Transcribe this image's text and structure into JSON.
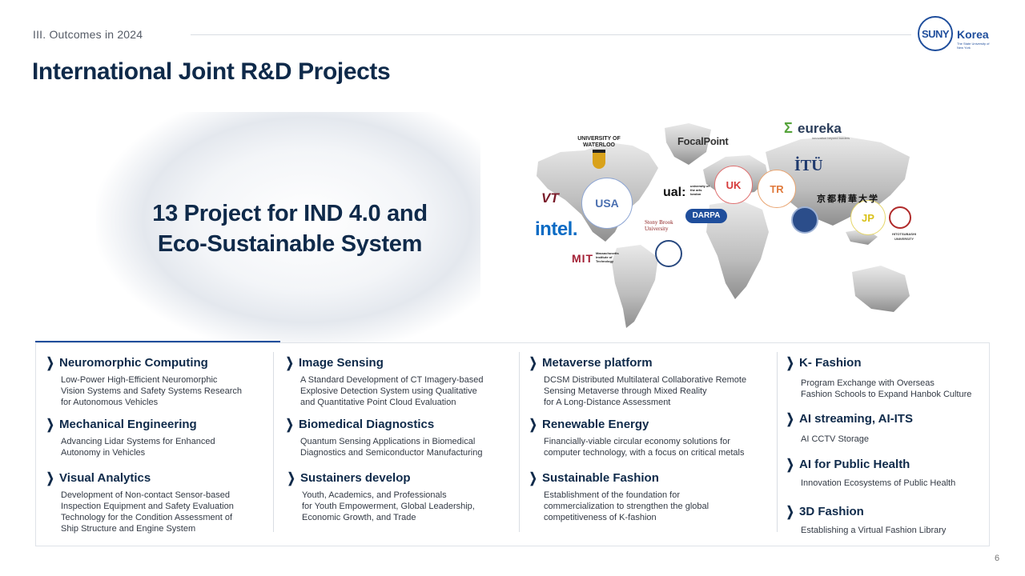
{
  "header": {
    "section_label": "III. Outcomes in 2024",
    "title": "International Joint R&D Projects"
  },
  "logo": {
    "mark": "SUNY",
    "word": "Korea",
    "subtitle": "The State University of New York"
  },
  "hero": {
    "line1": "13 Project for IND 4.0 and",
    "line2": "Eco-Sustainable System"
  },
  "map": {
    "countries": [
      {
        "code": "USA",
        "color": "#4a6fb0"
      },
      {
        "code": "UK",
        "color": "#d63a3a"
      },
      {
        "code": "TR",
        "color": "#e07a3c"
      },
      {
        "code": "JP",
        "color": "#d9c11a"
      }
    ],
    "partners": {
      "waterloo": "UNIVERSITY OF WATERLOO",
      "focalpoint": "FocalPoint",
      "eureka": "eureka",
      "eureka_tag": "innovation beyond borders",
      "itu": "İTÜ",
      "ual": "ual:",
      "ual_sub": "university of the arts london",
      "stony_brook": "Stony Brook University",
      "darpa": "DARPA",
      "intel": "intel.",
      "mit": "MIT",
      "mit_sub": "Massachusetts Institute of Technology",
      "kyoto": "京都精華大学",
      "hitotsubashi": "HITOTSUBASHI UNIVERSITY",
      "vt": "VT"
    }
  },
  "columns": [
    {
      "items": [
        {
          "title": "Neuromorphic  Computing",
          "desc": "Low-Power High-Efficient  Neuromorphic\nVision Systems and  Safety Systems Research\nfor  Autonomous Vehicles"
        },
        {
          "title": "Mechanical  Engineering",
          "desc": "Advancing Lidar Systems for Enhanced\nAutonomy in Vehicles"
        },
        {
          "title": "Visual  Analytics",
          "desc": "Development of Non-contact Sensor-based\nInspection Equipment and Safety Evaluation\nTechnology for the Condition Assessment of\nShip Structure and Engine System"
        }
      ]
    },
    {
      "items": [
        {
          "title": "Image Sensing",
          "desc": "A Standard Development of CT Imagery-based\nExplosive Detection System using Qualitative\nand Quantitative Point Cloud Evaluation"
        },
        {
          "title": "Biomedical Diagnostics",
          "desc": "Quantum Sensing Applications in Biomedical\nDiagnostics and Semiconductor Manufacturing"
        },
        {
          "title": "Sustainers develop",
          "desc": "Youth, Academics, and Professionals\nfor Youth Empowerment, Global Leadership,\nEconomic Growth, and Trade"
        }
      ]
    },
    {
      "items": [
        {
          "title": "Metaverse platform",
          "desc": "DCSM Distributed Multilateral Collaborative Remote\nSensing Metaverse through Mixed Reality\nfor A Long-Distance Assessment"
        },
        {
          "title": "Renewable Energy",
          "desc": "Financially-viable circular economy solutions for\ncomputer technology, with a focus on critical metals"
        },
        {
          "title": "Sustainable Fashion",
          "desc": "Establishment of the foundation for\ncommercialization to  strengthen the global\ncompetitiveness of K-fashion"
        }
      ]
    },
    {
      "items": [
        {
          "title": "K- Fashion",
          "desc": "Program Exchange with Overseas\nFashion Schools to Expand Hanbok Culture"
        },
        {
          "title": "AI streaming, AI-ITS",
          "desc": "AI CCTV Storage"
        },
        {
          "title": "AI for Public Health",
          "desc": "Innovation Ecosystems of Public Health"
        },
        {
          "title": "3D Fashion",
          "desc": "Establishing a Virtual Fashion Library"
        }
      ]
    }
  ],
  "footer": {
    "page_number": "6"
  },
  "colors": {
    "navy": "#0f2a4a",
    "accent": "#1f4e9c"
  }
}
